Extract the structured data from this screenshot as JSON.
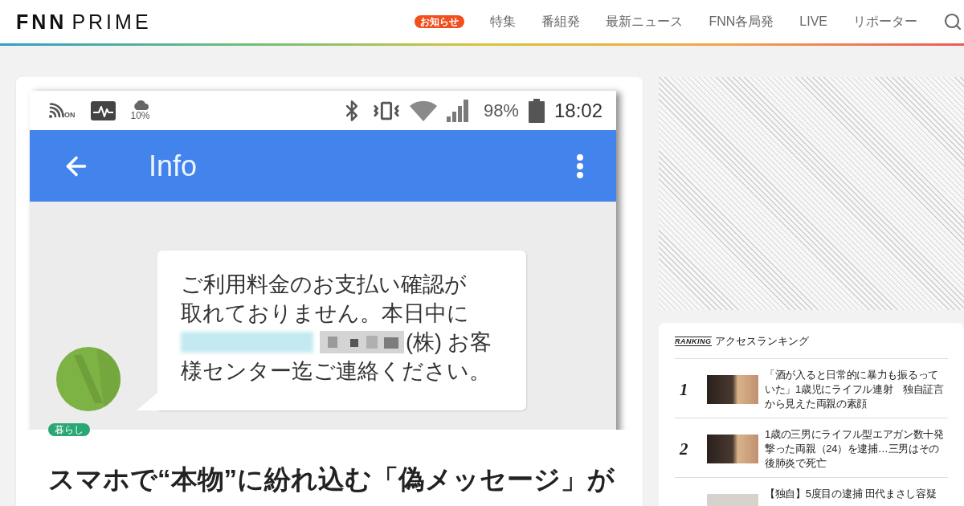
{
  "header": {
    "logo": {
      "brand": "FNN",
      "product": "PRIME"
    },
    "notice_badge": "お知らせ",
    "nav": [
      "特集",
      "番組発",
      "最新ニュース",
      "FNN各局発",
      "LIVE",
      "リポーター"
    ]
  },
  "article": {
    "image": {
      "status_bar": {
        "icons_left": [
          {
            "kind": "nfc",
            "label": "ON"
          },
          {
            "kind": "activity"
          },
          {
            "kind": "weather",
            "label": "10%"
          }
        ],
        "icons_right": [
          {
            "kind": "bluetooth"
          },
          {
            "kind": "vibrate"
          },
          {
            "kind": "wifi"
          },
          {
            "kind": "signal"
          }
        ],
        "battery": "98%",
        "time": "18:02"
      },
      "app_bar": {
        "title": "Info"
      },
      "message": {
        "lines": [
          "ご利用料金のお支払い確認が",
          "取れておりません。本日中に",
          "(株) お客",
          "様センター迄ご連絡ください。"
        ]
      }
    },
    "category": "暮らし",
    "title": "スマホで“本物”に紛れ込む「偽メッセージ」が"
  },
  "ranking": {
    "badge": "RANKING",
    "title": "アクセスランキング",
    "items": [
      {
        "rank": "1",
        "title": "「酒が入ると日常的に暴力も振るっていた」1歳児にライフル連射　独自証言から見えた両親の素顔"
      },
      {
        "rank": "2",
        "title": "1歳の三男にライフル型エアガン数十発撃った両親（24）を逮捕…三男はその後肺炎で死亡"
      },
      {
        "title": "【独自】5度目の逮捕 田代まさし容疑"
      }
    ]
  }
}
